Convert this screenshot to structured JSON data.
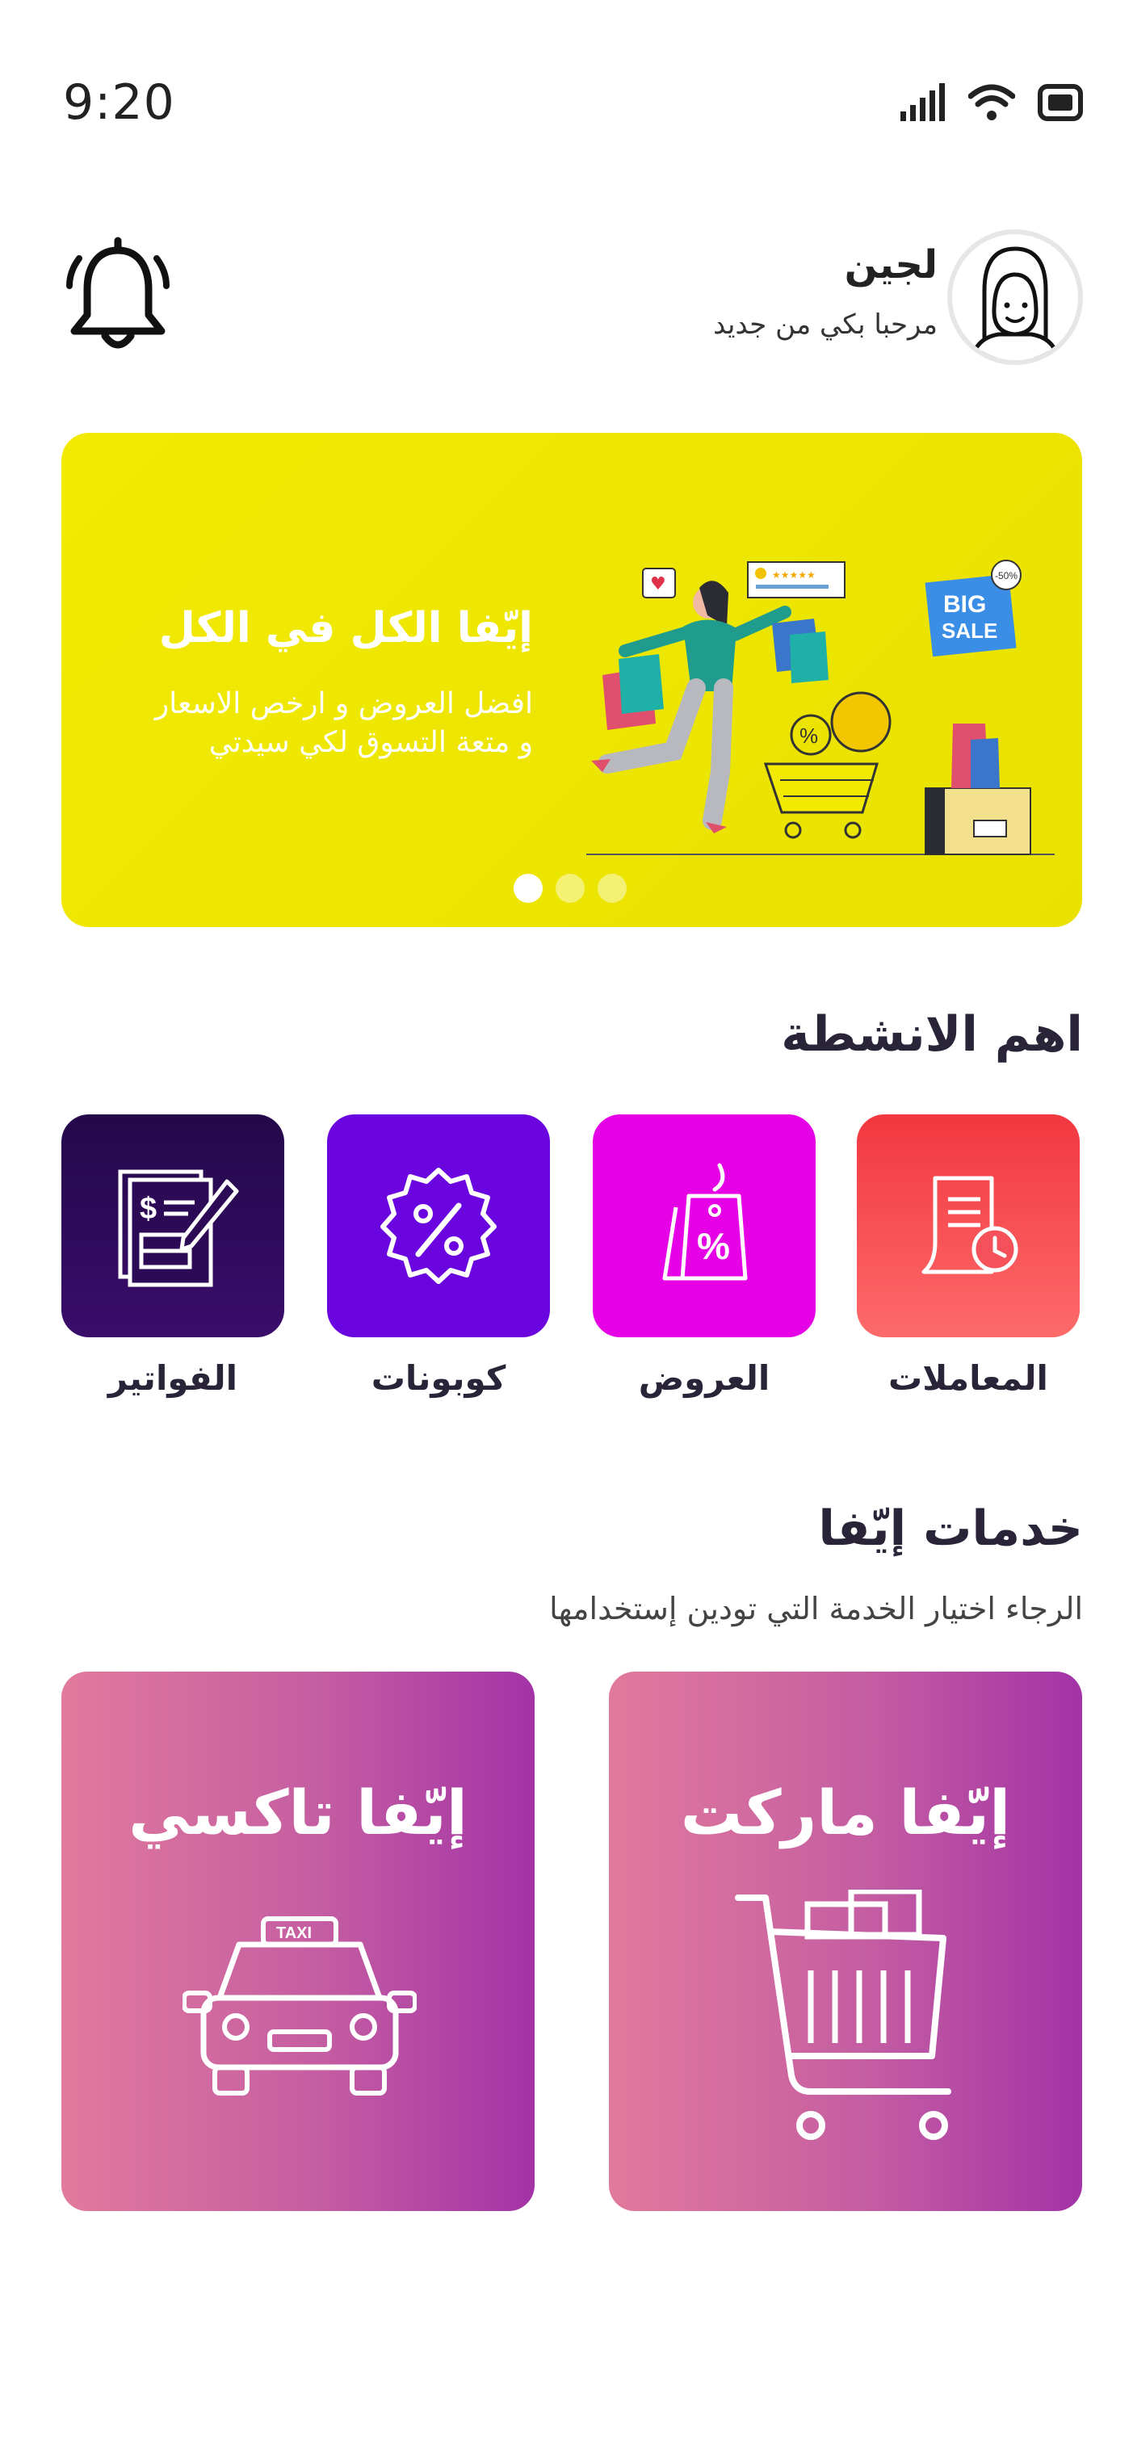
{
  "status_bar": {
    "time": "9:20",
    "icons": [
      "signal-icon",
      "wifi-icon",
      "battery-icon"
    ]
  },
  "header": {
    "user_name": "لجين",
    "greeting": "مرحبا بكي من جديد",
    "icons": [
      "bell-icon",
      "avatar"
    ]
  },
  "banner": {
    "title": "إيّفا الكل في الكل",
    "subtitle_line1": "افضل العروض و ارخص الاسعار",
    "subtitle_line2": "و متعة التسوق لكي سيدتي",
    "illustration_text": {
      "big": "BIG",
      "sale": "SALE",
      "discount": "-50%",
      "percent": "%"
    },
    "dots_count": 3,
    "active_dot": 0
  },
  "activities": {
    "title": "اهم الانشطة",
    "items": [
      {
        "label": "المعاملات",
        "icon": "transactions-icon",
        "color": "#f4515a"
      },
      {
        "label": "العروض",
        "icon": "offers-tag-icon",
        "color": "#e600e6"
      },
      {
        "label": "كوبونات",
        "icon": "coupon-icon",
        "color": "#6a05e0"
      },
      {
        "label": "الفواتير",
        "icon": "bills-icon",
        "color": "#2d0a55"
      }
    ]
  },
  "services": {
    "title": "خدمات إيّفا",
    "subtitle": "الرجاء اختيار الخدمة التي تودين إستخدامها",
    "items": [
      {
        "label": "إيّفا ماركت",
        "icon": "shopping-cart-icon"
      },
      {
        "label": "إيّفا تاكسي",
        "icon": "taxi-icon",
        "sign": "TAXI"
      }
    ]
  }
}
